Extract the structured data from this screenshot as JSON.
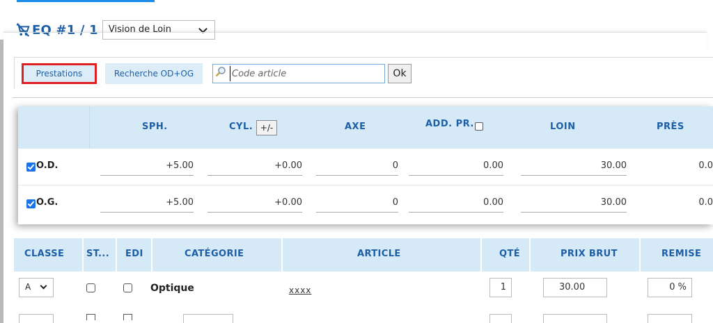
{
  "equipment": {
    "title": "EQ #1 / 1",
    "vision_selected": "Vision de Loin"
  },
  "toolbar": {
    "tab_prestations": "Prestations",
    "tab_recherche": "Recherche OD+OG",
    "search_placeholder": "Code article",
    "ok_label": "Ok"
  },
  "prescription": {
    "headers": {
      "sph": "SPH.",
      "cyl": "CYL.",
      "cyl_toggle": "+/-",
      "axe": "AXE",
      "add": "ADD. PR.",
      "loin": "LOIN",
      "pres": "PRÈS"
    },
    "rows": [
      {
        "eye": "O.D.",
        "checked": true,
        "sph": "+5.00",
        "cyl": "+0.00",
        "axe": "0",
        "add": "0.00",
        "loin": "30.00",
        "pres": "0.0"
      },
      {
        "eye": "O.G.",
        "checked": true,
        "sph": "+5.00",
        "cyl": "+0.00",
        "axe": "0",
        "add": "0.00",
        "loin": "30.00",
        "pres": "0.0"
      }
    ]
  },
  "table": {
    "headers": {
      "classe": "CLASSE",
      "st": "ST...",
      "edi": "EDI",
      "categorie": "CATÉGORIE",
      "article": "ARTICLE",
      "qte": "QTÉ",
      "prix_brut": "PRIX BRUT",
      "remise": "REMISE"
    },
    "rows": [
      {
        "classe": "A",
        "st": false,
        "edi": false,
        "categorie": "Optique",
        "article": "xxxx",
        "qte": "1",
        "prix_brut": "30.00",
        "remise": "0 %"
      }
    ]
  },
  "colors": {
    "accent": "#1c5fa6",
    "header_bg": "#d6e9f6",
    "highlight": "#e02020"
  }
}
